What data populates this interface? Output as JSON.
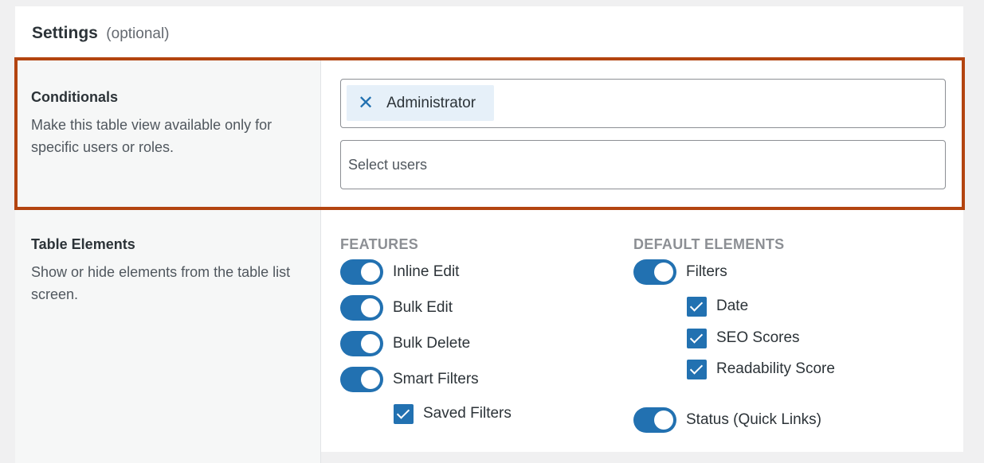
{
  "header": {
    "title": "Settings",
    "optional": "(optional)"
  },
  "conditionals": {
    "title": "Conditionals",
    "description": "Make this table view available only for specific users or roles.",
    "selected_roles": [
      "Administrator"
    ],
    "users_placeholder": "Select users",
    "users_value": ""
  },
  "table_elements": {
    "title": "Table Elements",
    "description": "Show or hide elements from the table list screen.",
    "features": {
      "title": "FEATURES",
      "items": [
        {
          "label": "Inline Edit",
          "enabled": true
        },
        {
          "label": "Bulk Edit",
          "enabled": true
        },
        {
          "label": "Bulk Delete",
          "enabled": true
        },
        {
          "label": "Smart Filters",
          "enabled": true
        }
      ],
      "sub_items": [
        {
          "label": "Saved Filters",
          "checked": true
        }
      ]
    },
    "default_elements": {
      "title": "DEFAULT ELEMENTS",
      "filters": {
        "label": "Filters",
        "enabled": true
      },
      "filter_options": [
        {
          "label": "Date",
          "checked": true
        },
        {
          "label": "SEO Scores",
          "checked": true
        },
        {
          "label": "Readability Score",
          "checked": true
        }
      ],
      "status": {
        "label": "Status (Quick Links)",
        "enabled": true
      }
    }
  },
  "colors": {
    "accent": "#2271b1",
    "highlight": "#b34410"
  },
  "icons": {
    "chip_remove": "close-icon"
  }
}
